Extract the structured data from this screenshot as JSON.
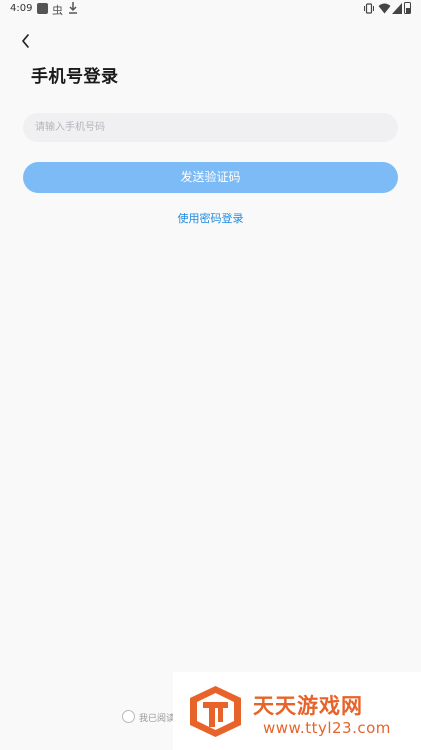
{
  "status_bar": {
    "time": "4:09",
    "notification_app_glyph": "虫",
    "icons": [
      "notification-square-icon",
      "app-notification-icon",
      "download-icon",
      "vibrate-icon",
      "wifi-icon",
      "signal-icon",
      "battery-icon"
    ]
  },
  "header": {
    "back_icon": "back-arrow-icon",
    "title": "手机号登录"
  },
  "form": {
    "phone_placeholder": "请输入手机号码",
    "phone_value": "",
    "send_code_label": "发送验证码",
    "password_login_label": "使用密码登录"
  },
  "agreement": {
    "text": "我已阅读",
    "checked": false
  },
  "watermark": {
    "name": "天天游戏网",
    "url": "www.ttyl23.com"
  },
  "colors": {
    "background": "#f9f9fa",
    "input_background": "#f0f0f3",
    "primary_button_disabled": "#7dbbf7",
    "link": "#1f8be0",
    "watermark_orange": "#e8632a"
  }
}
